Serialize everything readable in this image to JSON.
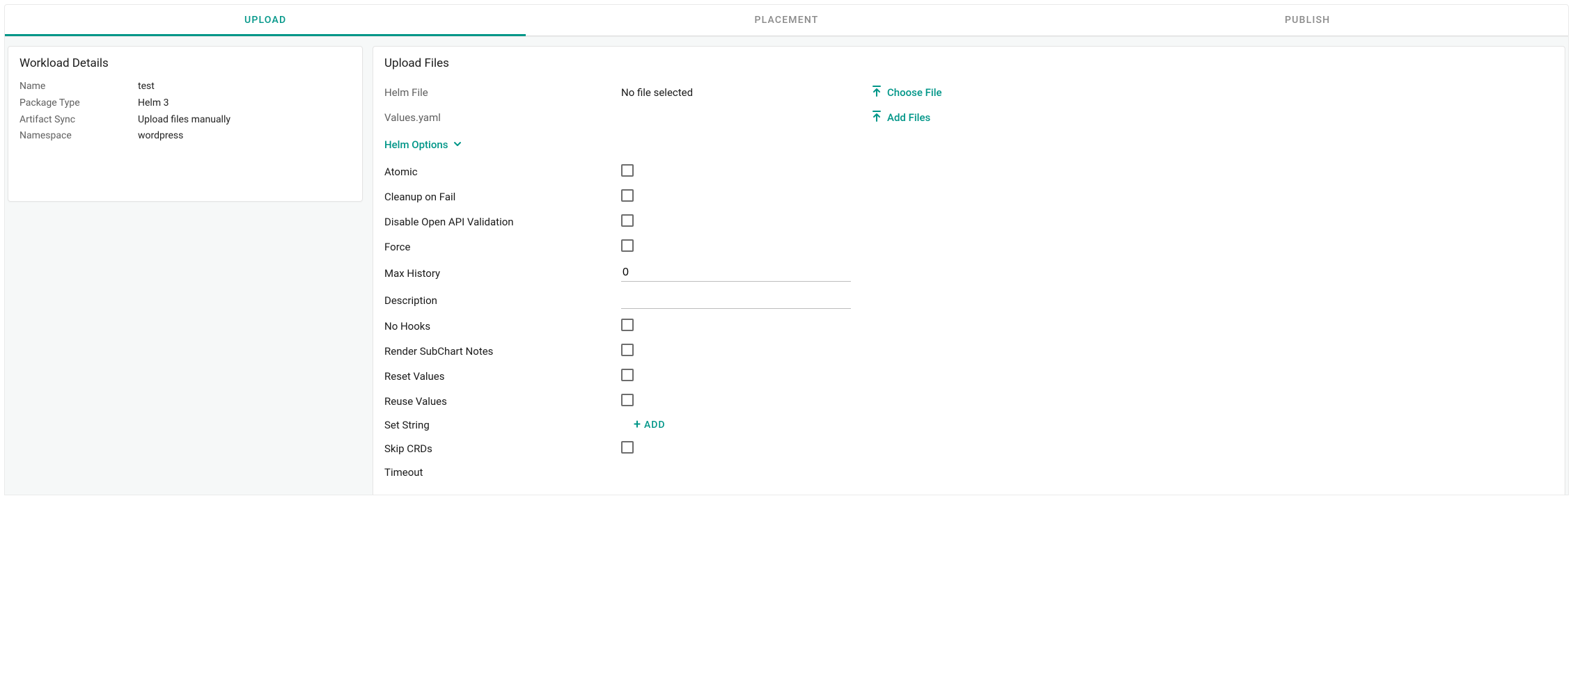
{
  "tabs": {
    "upload": "UPLOAD",
    "placement": "PLACEMENT",
    "publish": "PUBLISH"
  },
  "side": {
    "title": "Workload Details",
    "rows": {
      "name": {
        "k": "Name",
        "v": "test"
      },
      "package_type": {
        "k": "Package Type",
        "v": "Helm 3"
      },
      "artifact_sync": {
        "k": "Artifact Sync",
        "v": "Upload files manually"
      },
      "namespace": {
        "k": "Namespace",
        "v": "wordpress"
      }
    }
  },
  "main": {
    "title": "Upload Files",
    "helm_file_label": "Helm File",
    "helm_file_status": "No file selected",
    "choose_file_label": "Choose File",
    "values_label": "Values.yaml",
    "add_files_label": "Add Files",
    "helm_options_toggle": "Helm Options",
    "options": {
      "atomic": "Atomic",
      "cleanup_on_fail": "Cleanup on Fail",
      "disable_open_api": "Disable Open API Validation",
      "force": "Force",
      "max_history_label": "Max History",
      "max_history_value": "0",
      "description_label": "Description",
      "description_value": "",
      "no_hooks": "No Hooks",
      "render_subchart": "Render SubChart Notes",
      "reset_values": "Reset Values",
      "reuse_values": "Reuse Values",
      "set_string": "Set String",
      "add_label": "ADD",
      "skip_crds": "Skip CRDs",
      "timeout": "Timeout"
    }
  },
  "colors": {
    "accent": "#009688"
  }
}
